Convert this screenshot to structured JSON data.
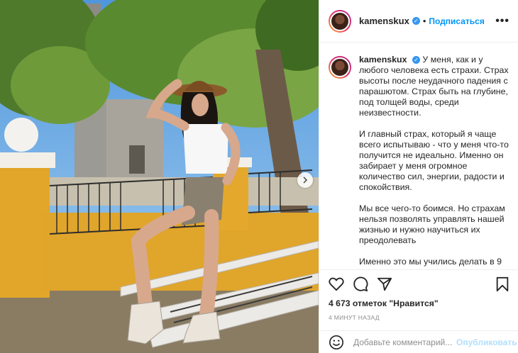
{
  "post": {
    "username": "kamenskux",
    "follow_label": "Подписаться",
    "more_label": "•••",
    "dot": "•",
    "caption": {
      "username": "kamenskux",
      "paragraph_1": "У меня, как и у любого человека есть страхи. Страх высоты после неудачного падения с парашютом. Страх быть на глубине, под толщей воды, среди неизвестности.",
      "paragraph_2": "И главный страх, который я чаще всего испытываю - что у меня что-то получится не идеально. Именно он забирает у меня огромное количество сил, энергии, радости и спокойствия.",
      "paragraph_3": "Мы все чего-то боимся. Но страхам нельзя позволять управлять нашей жизнью и нужно научиться их преодолевать",
      "paragraph_4": "Именно это мы учились делать в 9"
    },
    "likes": "4 673 отметок \"Нравится\"",
    "timestamp": "4 МИНУТ НАЗАД",
    "comment_placeholder": "Добавьте комментарий...",
    "post_label": "Опубликовать"
  },
  "colors": {
    "accent": "#0095f6",
    "verified": "#3897f0",
    "text": "#262626",
    "muted": "#8e8e8e",
    "post_disabled": "#b2dffc"
  },
  "icons": [
    "verified-badge-icon",
    "more-icon",
    "heart-icon",
    "comment-icon",
    "share-icon",
    "bookmark-icon",
    "emoji-icon",
    "next-arrow-icon"
  ]
}
